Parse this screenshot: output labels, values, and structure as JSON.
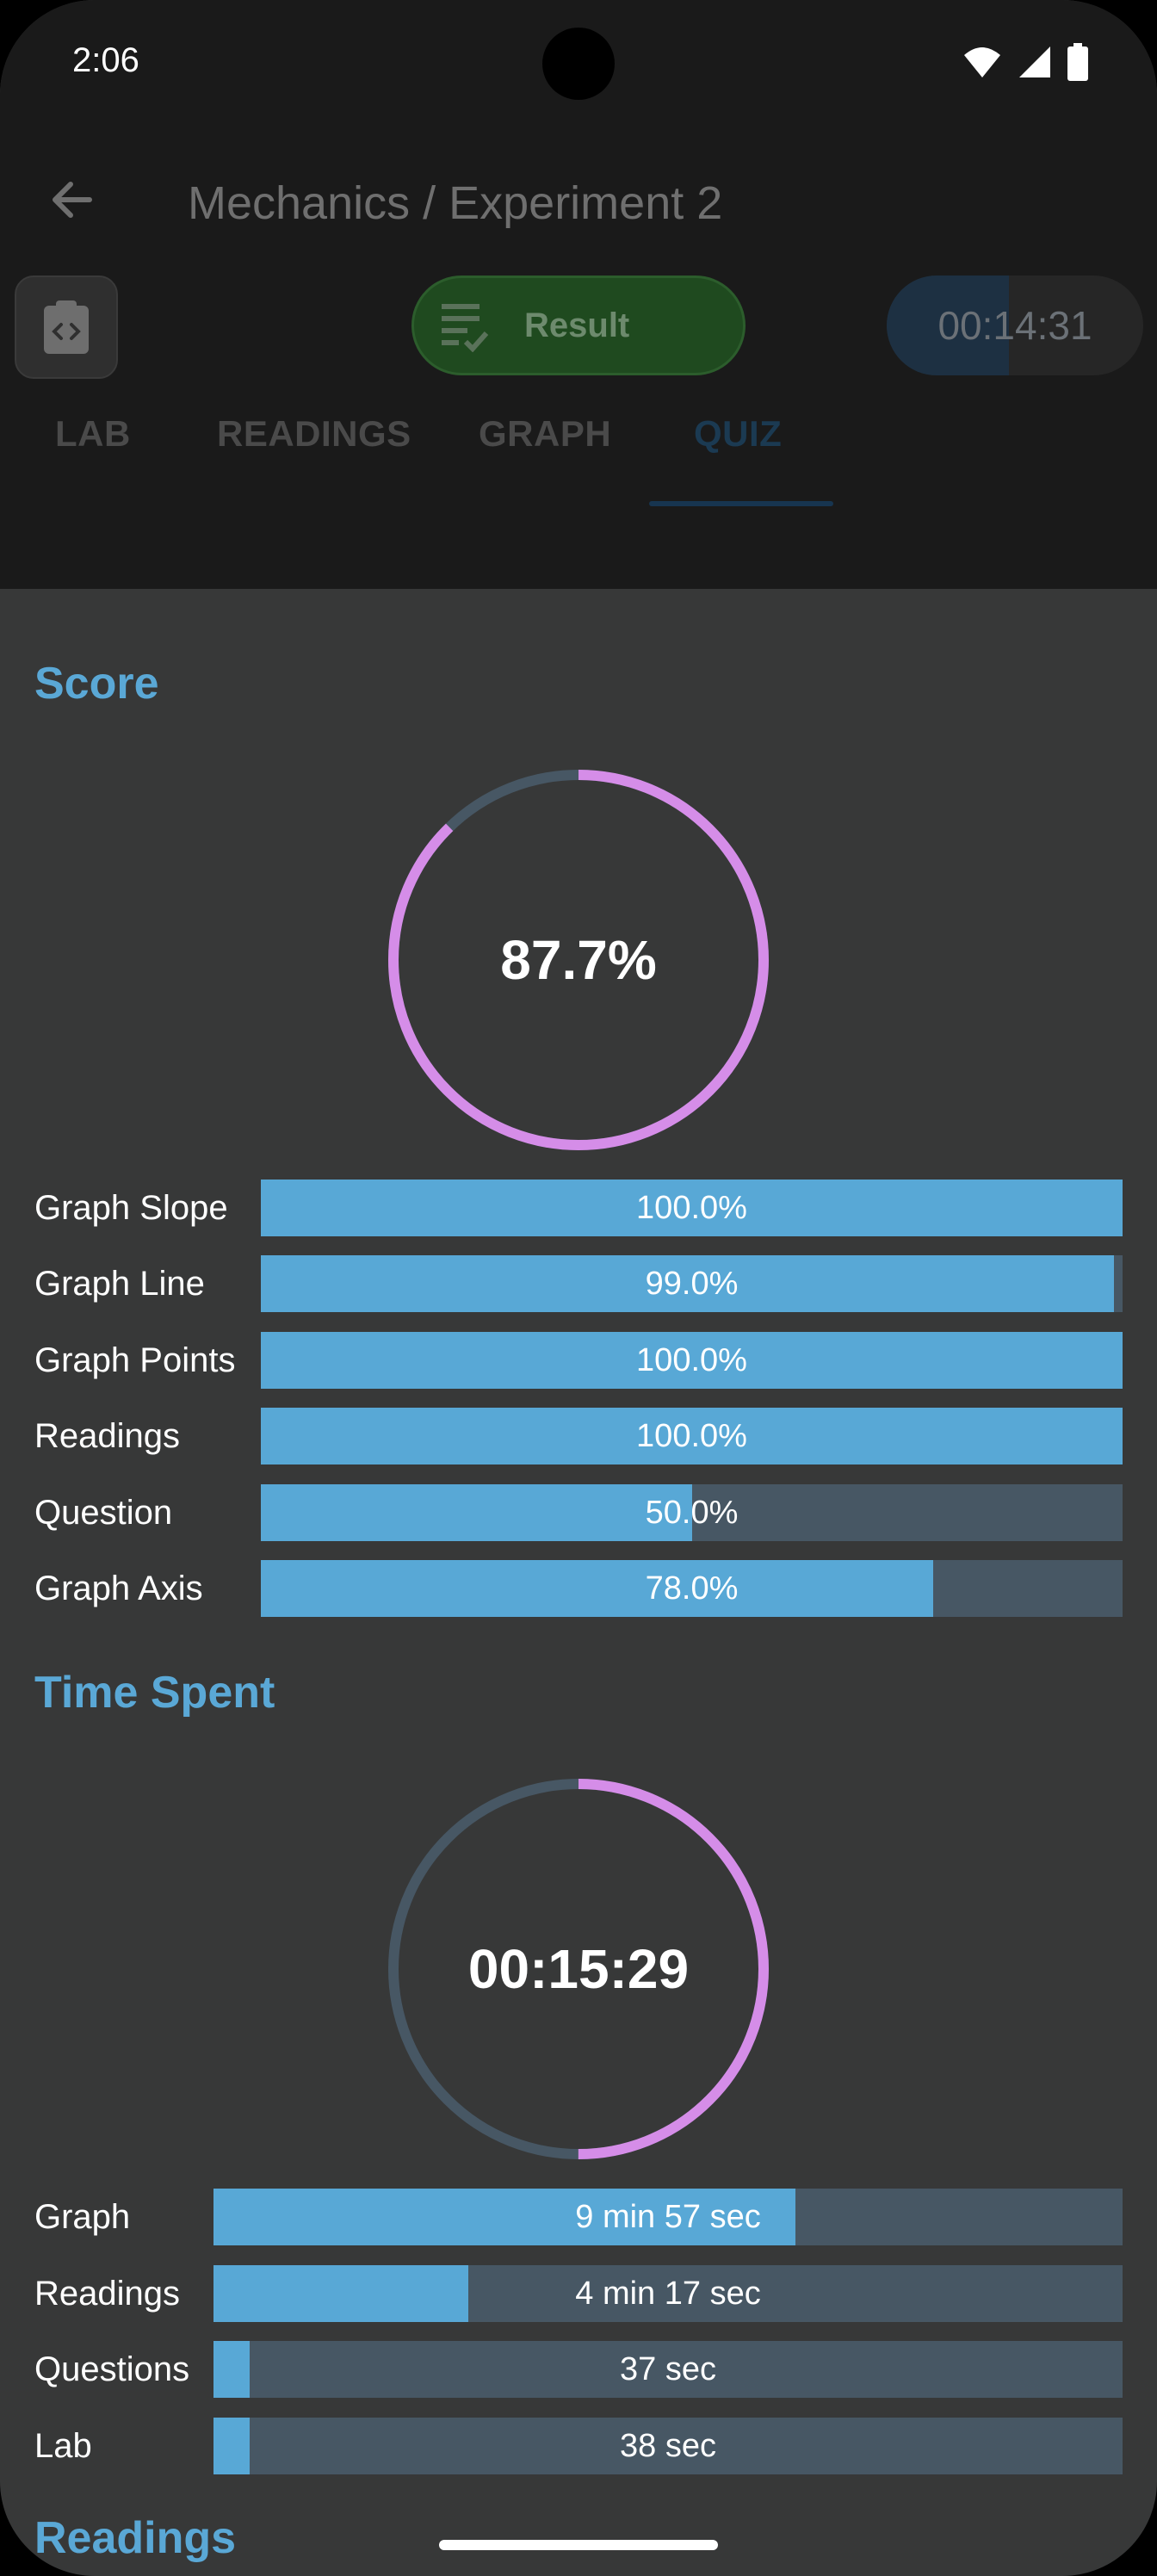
{
  "status_bar": {
    "time": "2:06"
  },
  "header": {
    "title": "Mechanics / Experiment 2",
    "result_label": "Result",
    "timer": "00:14:31"
  },
  "tabs": [
    {
      "label": "LAB",
      "active": false
    },
    {
      "label": "READINGS",
      "active": false
    },
    {
      "label": "GRAPH",
      "active": false
    },
    {
      "label": "QUIZ",
      "active": true
    }
  ],
  "score": {
    "title": "Score",
    "total_text": "87.7%",
    "total_fraction": 0.877,
    "rows": [
      {
        "label": "Graph Slope",
        "value_text": "100.0%",
        "fraction": 1.0
      },
      {
        "label": "Graph Line",
        "value_text": "99.0%",
        "fraction": 0.99
      },
      {
        "label": "Graph Points",
        "value_text": "100.0%",
        "fraction": 1.0
      },
      {
        "label": "Readings",
        "value_text": "100.0%",
        "fraction": 1.0
      },
      {
        "label": "Question",
        "value_text": "50.0%",
        "fraction": 0.5
      },
      {
        "label": "Graph Axis",
        "value_text": "78.0%",
        "fraction": 0.78
      }
    ]
  },
  "time_spent": {
    "title": "Time Spent",
    "total_text": "00:15:29",
    "total_fraction": 0.5,
    "rows": [
      {
        "label": "Graph",
        "value_text": "9 min 57 sec",
        "fraction": 0.64
      },
      {
        "label": "Readings",
        "value_text": "4 min 17 sec",
        "fraction": 0.28
      },
      {
        "label": "Questions",
        "value_text": "37 sec",
        "fraction": 0.04
      },
      {
        "label": "Lab",
        "value_text": "38 sec",
        "fraction": 0.04
      }
    ]
  },
  "readings_section": {
    "title": "Readings"
  },
  "colors": {
    "accent_blue": "#58a8d6",
    "ring_progress": "#d58de8",
    "ring_track": "#475764",
    "result_green": "#1f4a1f"
  }
}
